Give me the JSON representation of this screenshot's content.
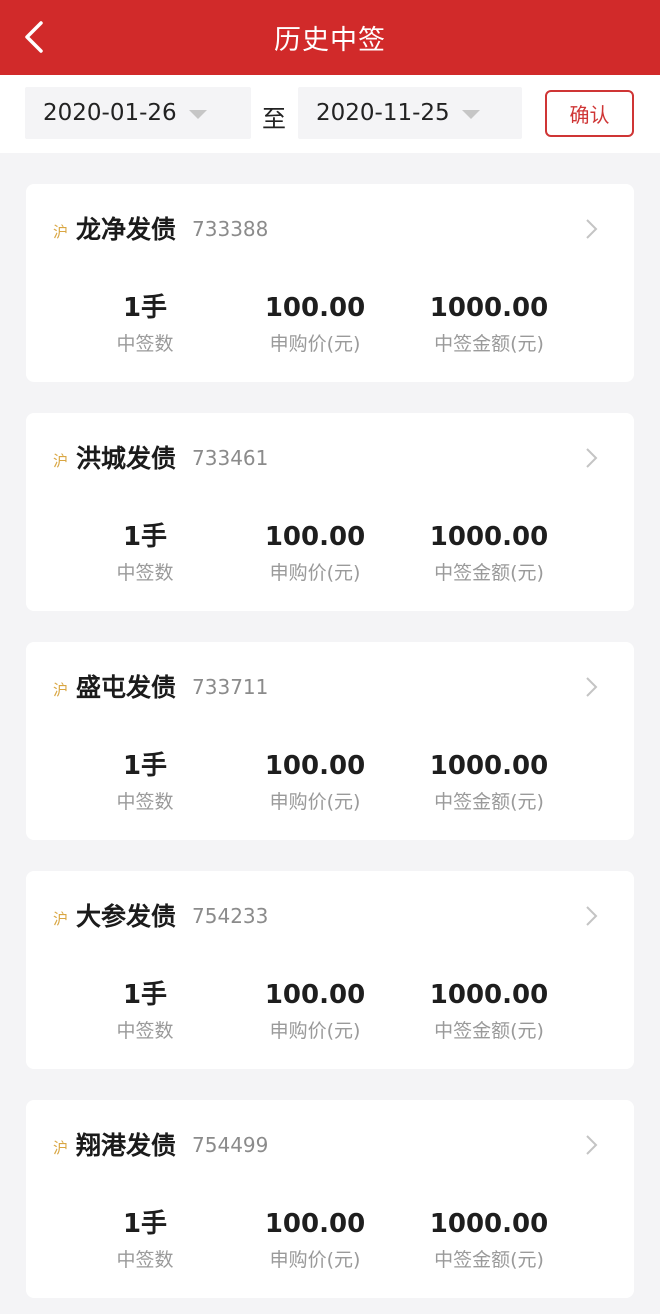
{
  "header": {
    "title": "历史中签"
  },
  "filter": {
    "start_date": "2020-01-26",
    "separator": "至",
    "end_date": "2020-11-25",
    "confirm_label": "确认"
  },
  "labels": {
    "count": "中签数",
    "price": "申购价(元)",
    "amount": "中签金额(元)"
  },
  "records": [
    {
      "market": "沪",
      "name": "龙净发债",
      "code": "733388",
      "count": "1手",
      "price": "100.00",
      "amount": "1000.00"
    },
    {
      "market": "沪",
      "name": "洪城发债",
      "code": "733461",
      "count": "1手",
      "price": "100.00",
      "amount": "1000.00"
    },
    {
      "market": "沪",
      "name": "盛屯发债",
      "code": "733711",
      "count": "1手",
      "price": "100.00",
      "amount": "1000.00"
    },
    {
      "market": "沪",
      "name": "大参发债",
      "code": "754233",
      "count": "1手",
      "price": "100.00",
      "amount": "1000.00"
    },
    {
      "market": "沪",
      "name": "翔港发债",
      "code": "754499",
      "count": "1手",
      "price": "100.00",
      "amount": "1000.00"
    }
  ]
}
